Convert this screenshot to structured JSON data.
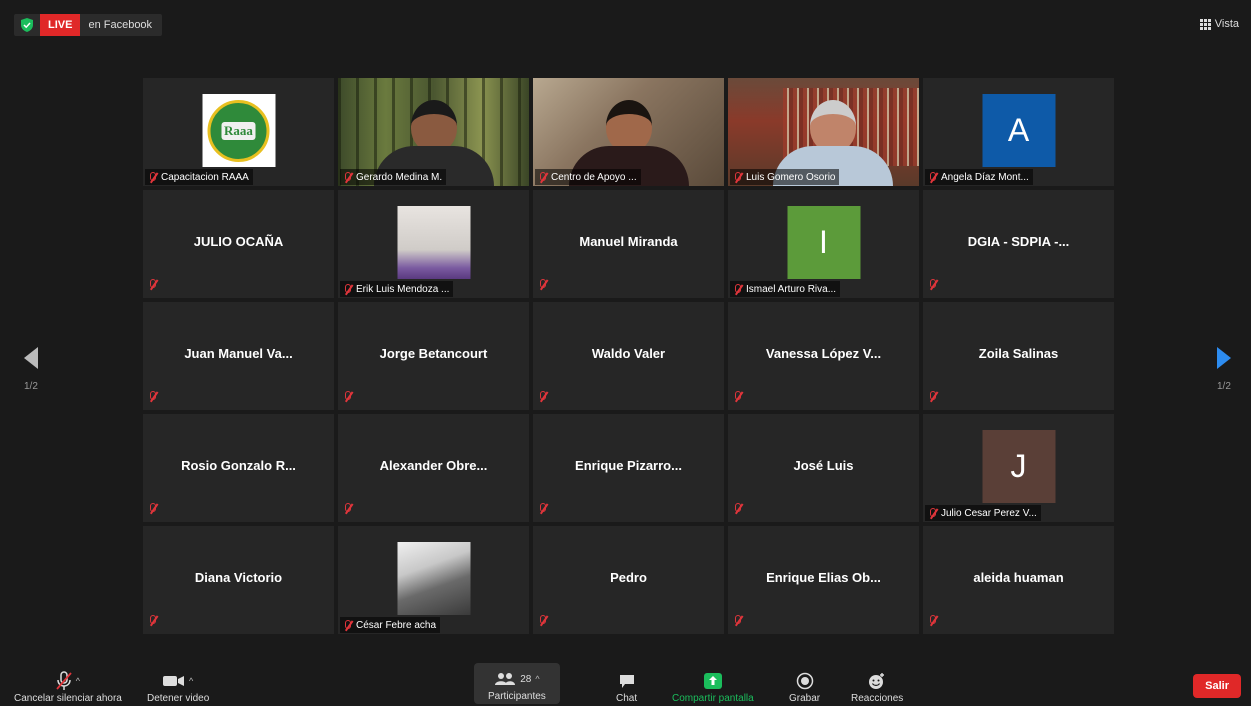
{
  "topbar": {
    "live": "LIVE",
    "target": "en Facebook",
    "view": "Vista"
  },
  "colors": {
    "accent": "#2d8cf0",
    "live": "#e02828",
    "active_border": "#d7e05a",
    "share": "#1bbd5c"
  },
  "tiles": [
    {
      "kind": "logo",
      "label": "Capacitacion RAAA",
      "logo_text": "Raaa"
    },
    {
      "kind": "video",
      "video": "forest",
      "label": "Gerardo Medina M."
    },
    {
      "kind": "video",
      "video": "room",
      "label": "Centro de Apoyo ..."
    },
    {
      "kind": "video",
      "video": "library",
      "label": "Luis Gomero Osorio",
      "active": true
    },
    {
      "kind": "avatar",
      "letter": "A",
      "color": "#0e5aa8",
      "label": "Angela Díaz Mont..."
    },
    {
      "kind": "name",
      "name": "JULIO OCAÑA"
    },
    {
      "kind": "photo",
      "photo": "family",
      "label": "Erik Luis Mendoza ..."
    },
    {
      "kind": "name",
      "name": "Manuel Miranda"
    },
    {
      "kind": "avatar",
      "letter": "I",
      "color": "#5c9b3a",
      "label": "Ismael Arturo Riva..."
    },
    {
      "kind": "name",
      "name": "DGIA - SDPIA -..."
    },
    {
      "kind": "name",
      "name": "Juan Manuel Va..."
    },
    {
      "kind": "name",
      "name": "Jorge Betancourt"
    },
    {
      "kind": "name",
      "name": "Waldo Valer"
    },
    {
      "kind": "name",
      "name": "Vanessa López V..."
    },
    {
      "kind": "name",
      "name": "Zoila Salinas"
    },
    {
      "kind": "name",
      "name": "Rosio Gonzalo R..."
    },
    {
      "kind": "name",
      "name": "Alexander Obre..."
    },
    {
      "kind": "name",
      "name": "Enrique Pizarro..."
    },
    {
      "kind": "name",
      "name": "José Luis"
    },
    {
      "kind": "avatar",
      "letter": "J",
      "color": "#5a3f37",
      "label": "Julio Cesar Perez V..."
    },
    {
      "kind": "name",
      "name": "Diana Victorio"
    },
    {
      "kind": "photo",
      "photo": "office",
      "label": "César Febre acha"
    },
    {
      "kind": "name",
      "name": "Pedro"
    },
    {
      "kind": "name",
      "name": "Enrique Elias Ob..."
    },
    {
      "kind": "name",
      "name": "aleida huaman"
    }
  ],
  "pager": {
    "left": "1/2",
    "right": "1/2"
  },
  "toolbar": {
    "mute": "Cancelar silenciar ahora",
    "video": "Detener video",
    "participants": "Participantes",
    "participants_count": "28",
    "chat": "Chat",
    "share": "Compartir pantalla",
    "record": "Grabar",
    "reactions": "Reacciones",
    "leave": "Salir"
  }
}
